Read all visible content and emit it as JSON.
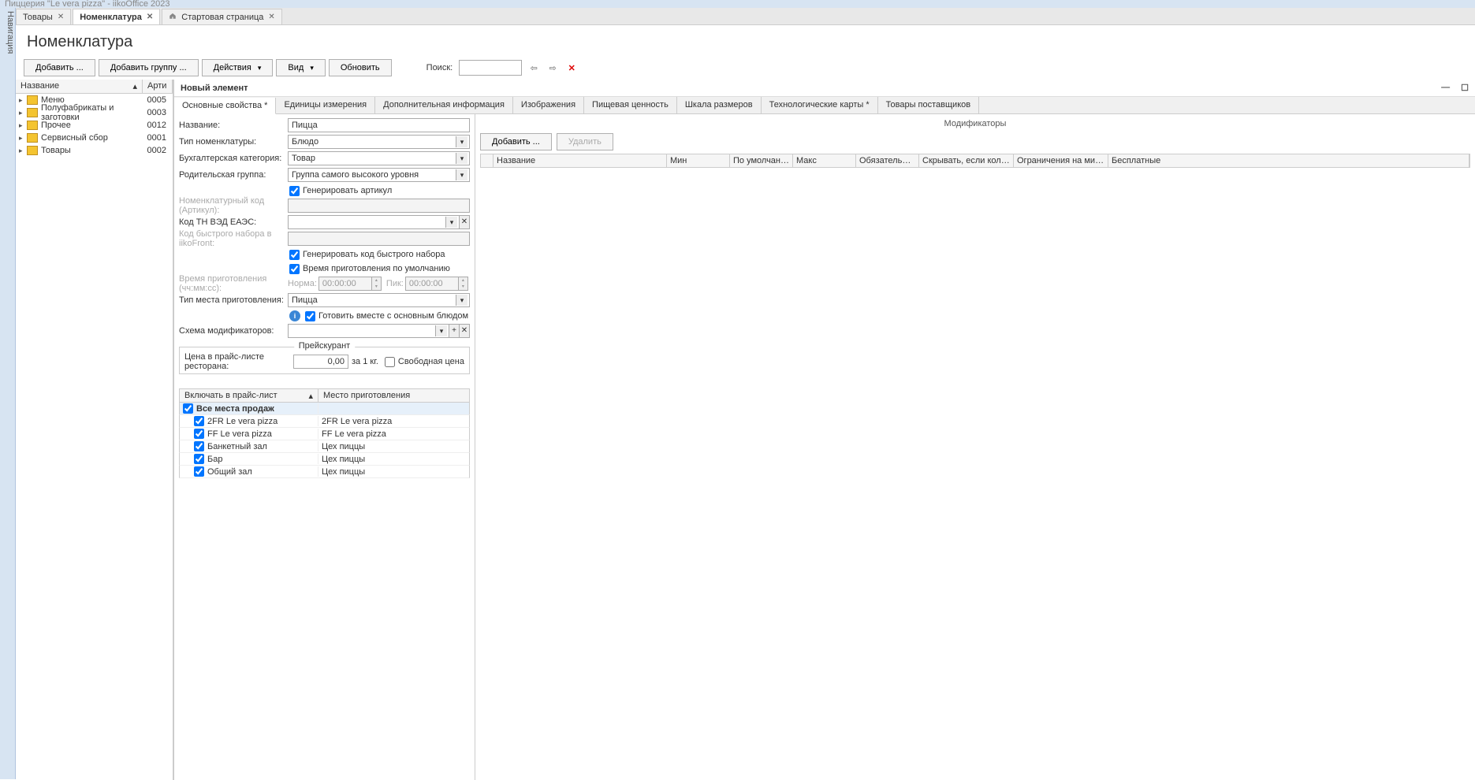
{
  "app_title": "Пиццерия \"Le vera pizza\" - iikoOffice 2023",
  "sidebar_label": "Навигация",
  "main_tabs": [
    {
      "label": "Товары",
      "active": false,
      "closable": true
    },
    {
      "label": "Номенклатура",
      "active": true,
      "closable": true
    },
    {
      "label": "Стартовая страница",
      "active": false,
      "closable": true,
      "home": true
    }
  ],
  "page_title": "Номенклатура",
  "toolbar": {
    "add": "Добавить ...",
    "add_group": "Добавить группу ...",
    "actions": "Действия",
    "view": "Вид",
    "refresh": "Обновить",
    "search_label": "Поиск:"
  },
  "tree": {
    "col_name": "Название",
    "col_code": "Арти",
    "rows": [
      {
        "name": "Меню",
        "code": "0005"
      },
      {
        "name": "Полуфабрикаты и заготовки",
        "code": "0003"
      },
      {
        "name": "Прочее",
        "code": "0012"
      },
      {
        "name": "Сервисный сбор",
        "code": "0001"
      },
      {
        "name": "Товары",
        "code": "0002"
      }
    ]
  },
  "editor": {
    "title": "Новый элемент",
    "tabs": [
      "Основные свойства *",
      "Единицы измерения",
      "Дополнительная информация",
      "Изображения",
      "Пищевая ценность",
      "Шкала размеров",
      "Технологические карты *",
      "Товары поставщиков"
    ],
    "form": {
      "name_label": "Название:",
      "name_value": "Пицца",
      "type_label": "Тип номенклатуры:",
      "type_value": "Блюдо",
      "acc_label": "Бухгалтерская категория:",
      "acc_value": "Товар",
      "parent_label": "Родительская группа:",
      "parent_value": "Группа самого высокого уровня",
      "gen_art": "Генерировать артикул",
      "sku_label": "Номенклатурный код (Артикул):",
      "eaes_label": "Код ТН ВЭД ЕАЭС:",
      "fast_label": "Код быстрого набора в iikoFront:",
      "gen_fast": "Генерировать код быстрого набора",
      "def_time": "Время приготовления по умолчанию",
      "cook_time_label": "Время приготовления (чч:мм:сс):",
      "norm": "Норма:",
      "norm_val": "00:00:00",
      "peak": "Пик:",
      "peak_val": "00:00:00",
      "place_label": "Тип места приготовления:",
      "place_value": "Пицца",
      "cook_with": "Готовить вместе с основным блюдом",
      "scheme_label": "Схема модификаторов:"
    },
    "pricelist": {
      "legend": "Прейскурант",
      "price_label": "Цена в прайс-листе ресторана:",
      "price_value": "0,00",
      "unit": "за 1 кг.",
      "free_price": "Свободная цена",
      "col1": "Включать в прайс-лист",
      "col2": "Место приготовления",
      "all": "Все места продаж",
      "rows": [
        {
          "name": "2FR Le vera pizza",
          "place": "2FR Le vera pizza"
        },
        {
          "name": "FF Le vera pizza",
          "place": "FF Le vera pizza"
        },
        {
          "name": "Банкетный зал",
          "place": "Цех пиццы"
        },
        {
          "name": "Бар",
          "place": "Цех пиццы"
        },
        {
          "name": "Общий зал",
          "place": "Цех пиццы"
        }
      ]
    },
    "mods": {
      "header": "Модификаторы",
      "add": "Добавить ...",
      "del": "Удалить",
      "cols": [
        "Название",
        "Мин",
        "По умолчанию",
        "Макс",
        "Обязательный",
        "Скрывать, если кол-во п...",
        "Ограничения на минимум ...",
        "Бесплатные"
      ]
    }
  }
}
